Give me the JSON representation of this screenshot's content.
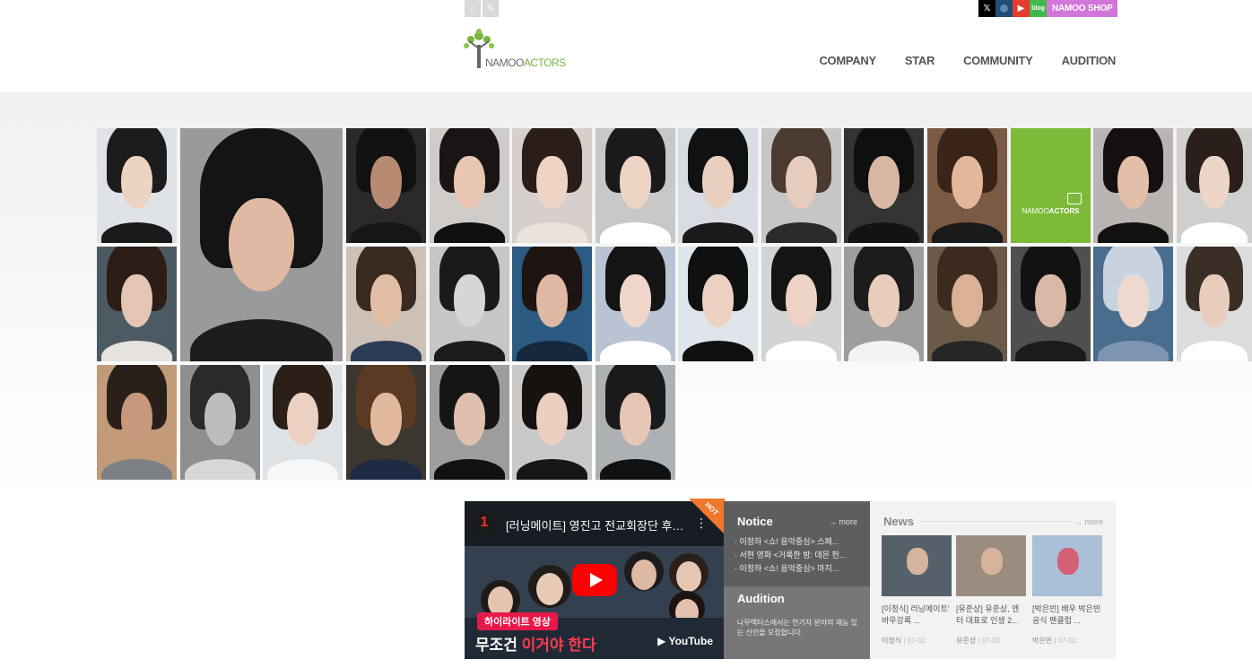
{
  "header": {
    "util_icons": [
      "home-icon",
      "pencil-icon"
    ],
    "sns": [
      {
        "icon": "x-icon",
        "label": "𝕏",
        "color": "#000000"
      },
      {
        "icon": "instagram-icon",
        "label": "◎",
        "color": "#1d4f78"
      },
      {
        "icon": "youtube-icon",
        "label": "▶",
        "color": "#e53c2f"
      },
      {
        "icon": "blog-icon",
        "label": "blog",
        "color": "#41b94a"
      }
    ],
    "shop_label": "NAMOO SHOP",
    "logo": {
      "part1": "NAMOO",
      "part2": "ACTORS"
    },
    "nav": [
      "COMPANY",
      "STAR",
      "COMMUNITY",
      "AUDITION"
    ]
  },
  "gallery": {
    "brand_tile": {
      "part1": "NAMOO",
      "part2": "ACTORS"
    },
    "tiles": [
      {
        "bg": "#dfe3e8",
        "hair": "#1c1c1c",
        "skin": "#ecd2c0",
        "cloth": "#1a1a1a"
      },
      {
        "bg": "#9a9a9a",
        "hair": "#141414",
        "skin": "#e0b9a2",
        "cloth": "#1d1d1d",
        "big": true
      },
      {
        "bg": "#2a2a2a",
        "hair": "#111111",
        "skin": "#b98a72",
        "cloth": "#161616"
      },
      {
        "bg": "#cfcbc8",
        "hair": "#1b1414",
        "skin": "#e8c6b2",
        "cloth": "#101010"
      },
      {
        "bg": "#d6cfcb",
        "hair": "#2b1e19",
        "skin": "#efd3c5",
        "cloth": "#e9e2dc"
      },
      {
        "bg": "#c8c8c8",
        "hair": "#1a1a1a",
        "skin": "#ecd4c4",
        "cloth": "#ffffff"
      },
      {
        "bg": "#d9dde3",
        "hair": "#111111",
        "skin": "#e9cfbe",
        "cloth": "#1a1a1a"
      },
      {
        "bg": "#c7c6c4",
        "hair": "#4a3a30",
        "skin": "#e7ccbd",
        "cloth": "#2b2b2b"
      },
      {
        "bg": "#333333",
        "hair": "#0f0f0f",
        "skin": "#d8b8a4",
        "cloth": "#131313"
      },
      {
        "bg": "#7b5a45",
        "hair": "#3a2418",
        "skin": "#e2b79c",
        "cloth": "#1a1a1a"
      },
      {
        "brand": true
      },
      {
        "bg": "#b9b4b1",
        "hair": "#141010",
        "skin": "#e3bea8",
        "cloth": "#111111"
      },
      {
        "bg": "#cfcfcf",
        "hair": "#2a1f1a",
        "skin": "#edd5c7",
        "cloth": "#ffffff"
      },
      {
        "bg": "#4c5b63",
        "hair": "#2c1d16",
        "skin": "#e4c5b4",
        "cloth": "#e6e3de"
      },
      {
        "bg": "#cdc1b7",
        "hair": "#3a2a20",
        "skin": "#e2bea5",
        "cloth": "#2d3c55"
      },
      {
        "bg": "#c6c6c6",
        "hair": "#1a1a1a",
        "skin": "#d6d6d6",
        "cloth": "#1c1c1c"
      },
      {
        "bg": "#2b5a82",
        "hair": "#1e1412",
        "skin": "#dfb9a4",
        "cloth": "#15283b"
      },
      {
        "bg": "#b9c3d4",
        "hair": "#141414",
        "skin": "#efd6cb",
        "cloth": "#ffffff"
      },
      {
        "bg": "#dfe5ea",
        "hair": "#101010",
        "skin": "#ecd0c2",
        "cloth": "#101010"
      },
      {
        "bg": "#d3d3d3",
        "hair": "#141414",
        "skin": "#ecd3c5",
        "cloth": "#ffffff"
      },
      {
        "bg": "#9e9e9e",
        "hair": "#1c1c1c",
        "skin": "#e8ccbc",
        "cloth": "#f3f3f3"
      },
      {
        "bg": "#6c5a48",
        "hair": "#3b2a1d",
        "skin": "#d9b197",
        "cloth": "#262626"
      },
      {
        "bg": "#4f4f4f",
        "hair": "#121212",
        "skin": "#d8b9a7",
        "cloth": "#1b1b1b"
      },
      {
        "bg": "#4b6d8d",
        "hair": "#c9d3df",
        "skin": "#eed9d1",
        "cloth": "#7e95b1"
      },
      {
        "bg": "#dcdcdc",
        "hair": "#3b2e26",
        "skin": "#e8cdbd",
        "cloth": "#ffffff"
      },
      {
        "bg": "#c19a78",
        "hair": "#2a1f18",
        "skin": "#c8987c",
        "cloth": "#7d8186"
      },
      {
        "bg": "#8f8f8f",
        "hair": "#2a2a2a",
        "skin": "#bdbdbd",
        "cloth": "#d7d7d7"
      },
      {
        "bg": "#dfe2e5",
        "hair": "#2b1f18",
        "skin": "#ecd1c3",
        "cloth": "#f7f7f7"
      },
      {
        "bg": "#3b3630",
        "hair": "#5a3a22",
        "skin": "#e0b99f",
        "cloth": "#1d2a44"
      },
      {
        "bg": "#9d9d9d",
        "hair": "#151515",
        "skin": "#e0bfae",
        "cloth": "#111111"
      },
      {
        "bg": "#c9c9c9",
        "hair": "#161210",
        "skin": "#ebcfc0",
        "cloth": "#161616"
      },
      {
        "bg": "#aeb1b4",
        "hair": "#1a1a1a",
        "skin": "#e6c7b6",
        "cloth": "#111111"
      }
    ]
  },
  "video": {
    "channel_icon": "1",
    "title": "[러닝메이트] 영진고 전교회장단 후…",
    "badge": "하이라이트 영상",
    "caption_a": "무조건 ",
    "caption_b": "이거야 한다",
    "youtube_label": "YouTube",
    "hot_label": "HOT"
  },
  "notice": {
    "title": "Notice",
    "more": "→ more",
    "items": [
      "· 이정하 <쇼! 음악중심> 스페...",
      "· 서현 영화 <거룩한 밤: 데몬 헌...",
      "· 이정하 <쇼! 음악중심> 마지..."
    ]
  },
  "audition": {
    "title": "Audition",
    "desc": "나무엑터스에서는 연기자 분야의 재능 있는 신인을 모집합니다."
  },
  "news": {
    "title": "News",
    "more": "→ more",
    "items": [
      {
        "title": "[이정식] 러닝메이트' 바우강록 ...",
        "author": "이정식",
        "date": "07-02",
        "bg": "#55606a",
        "skin": "#d6b39c"
      },
      {
        "title": "[유준상] 유준상, 엔터 대표로 인생 2...",
        "author": "유준상",
        "date": "07-02",
        "bg": "#9a8d80",
        "skin": "#d6b49c"
      },
      {
        "title": "[박은빈] 배우 박은빈 공식 팬클럽 ...",
        "author": "박은빈",
        "date": "07-02",
        "bg": "#a9c0d8",
        "skin": "#d65f78"
      }
    ]
  }
}
